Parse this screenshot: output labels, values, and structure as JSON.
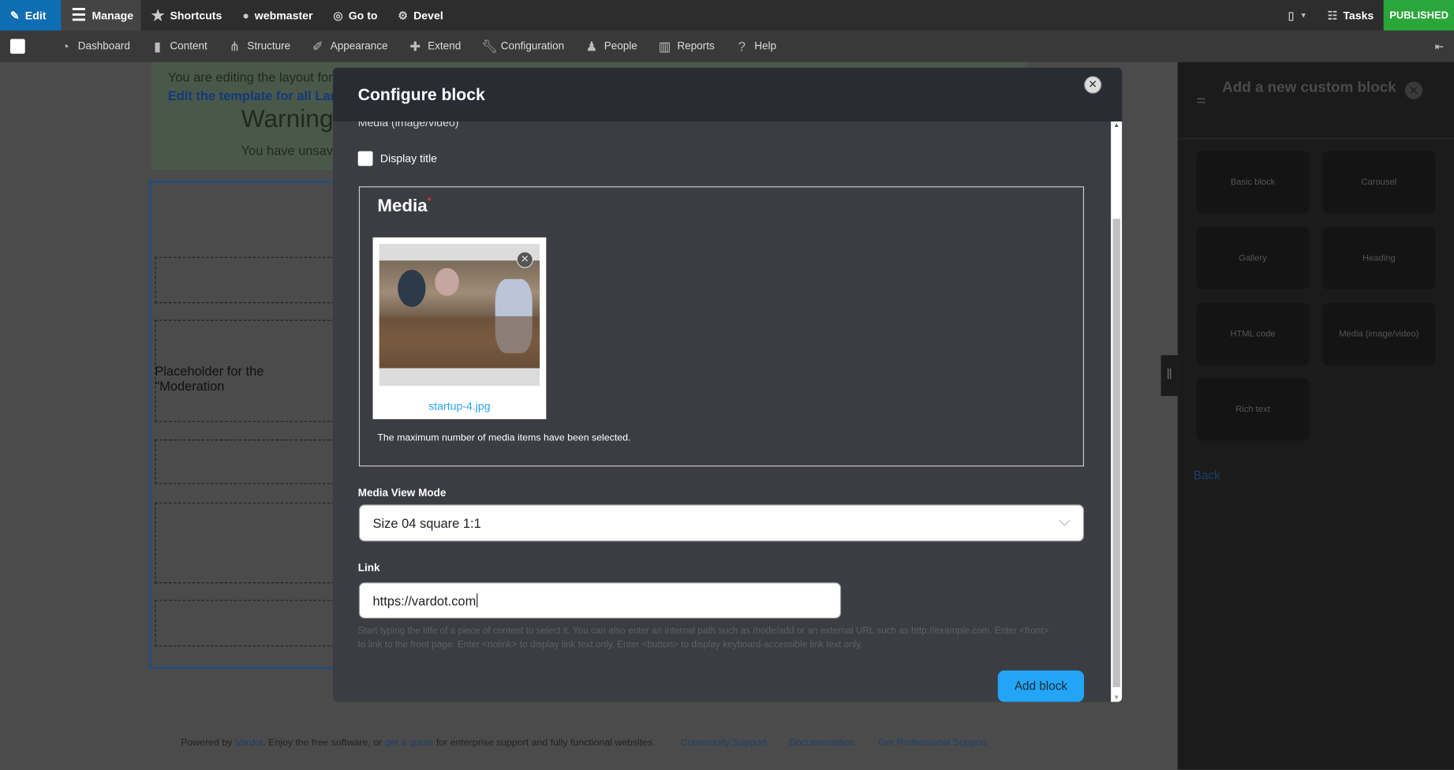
{
  "toolbar": {
    "edit": "Edit",
    "manage": "Manage",
    "shortcuts": "Shortcuts",
    "user": "webmaster",
    "goto": "Go to",
    "devel": "Devel",
    "tasks": "Tasks",
    "status": "PUBLISHED"
  },
  "menu": [
    "Dashboard",
    "Content",
    "Structure",
    "Appearance",
    "Extend",
    "Configuration",
    "People",
    "Reports",
    "Help"
  ],
  "page": {
    "msg_line1": "You are editing the layout for t",
    "msg_link": "Edit the template for all Lan",
    "warning": "Warning",
    "unsaved": "You have unsave",
    "placeholder": "Placeholder for the \"Moderation"
  },
  "footer": {
    "powered": "Powered by",
    "vardot": "Vardot",
    "enjoy": ". Enjoy the free software, or",
    "quote": "get a quote",
    "rest": "for enterprise support and fully functional websites.",
    "links": [
      "Community Support",
      "Documentation",
      "Get Professional Support"
    ]
  },
  "panel": {
    "title": "Add a new custom block",
    "tiles": [
      "Basic block",
      "Carousel",
      "Gallery",
      "Heading",
      "HTML code",
      "Media (image/video)",
      "Rich text"
    ],
    "back": "Back"
  },
  "modal": {
    "title": "Configure block",
    "cut_label": "Media (image/video)",
    "display_title": "Display title",
    "media_legend": "Media",
    "required": "*",
    "filename": "startup-4.jpg",
    "max_note": "The maximum number of media items have been selected.",
    "view_mode_label": "Media View Mode",
    "view_mode_value": "Size 04 square 1:1",
    "link_label": "Link",
    "link_value": "https://vardot.com",
    "help1": "Start typing the title of a piece of content to select it. You can also enter an internal path such as /node/add or an external URL such as http://example.com. Enter <front>",
    "help2": "to link to the front page. Enter <nolink> to display link text only. Enter <button> to display keyboard-accessible link text only.",
    "submit": "Add block"
  },
  "colors": {
    "edit": "#0f6db3",
    "published": "#2aa63a",
    "primary": "#22a5f6",
    "link": "#2ea3f2"
  }
}
